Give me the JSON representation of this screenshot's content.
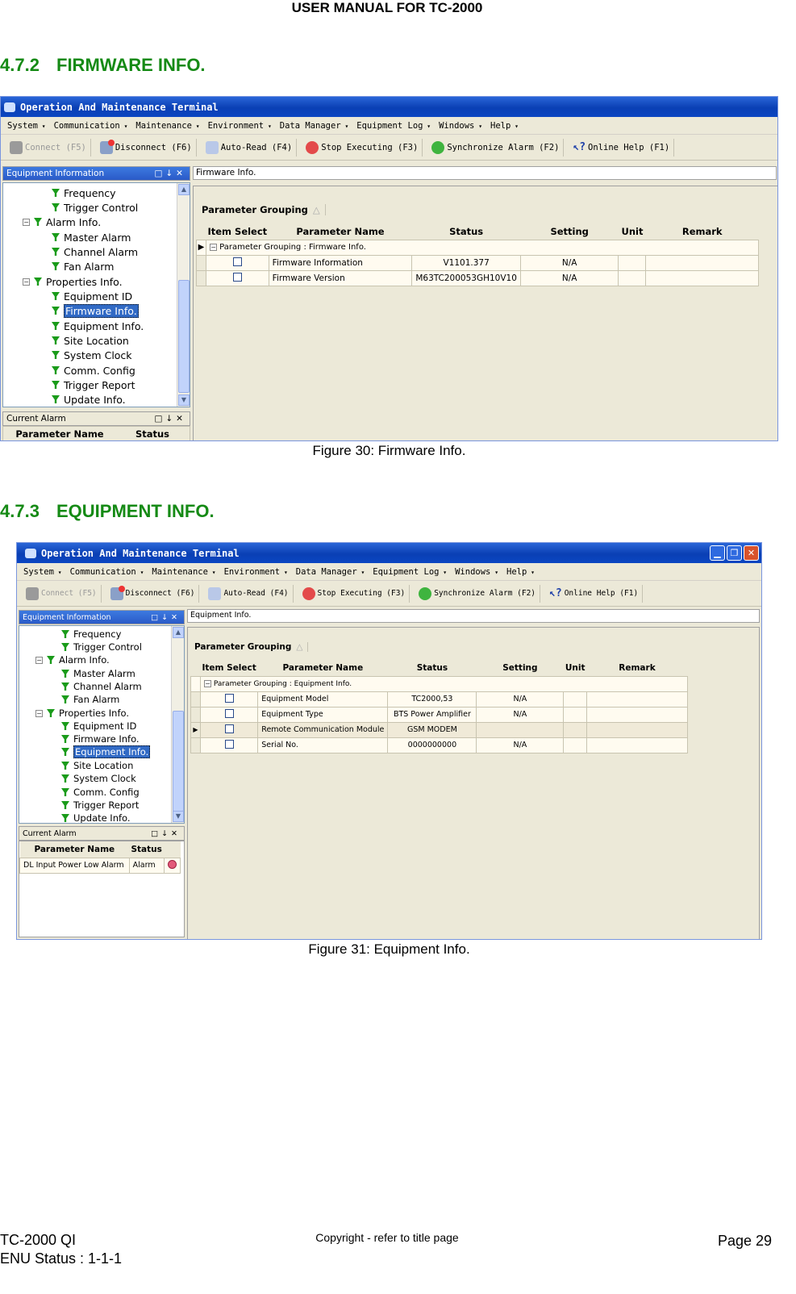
{
  "header": {
    "title": "USER MANUAL FOR TC-2000"
  },
  "section1": {
    "number": "4.7.2",
    "title": "FIRMWARE INFO."
  },
  "section2": {
    "number": "4.7.3",
    "title": "EQUIPMENT INFO."
  },
  "figure1": {
    "caption": "Figure 30: Firmware Info.",
    "window_title": "Operation And Maintenance Terminal",
    "menu": [
      "System",
      "Communication",
      "Maintenance",
      "Environment",
      "Data Manager",
      "Equipment Log",
      "Windows",
      "Help"
    ],
    "toolbar": [
      "Connect (F5)",
      "Disconnect (F6)",
      "Auto-Read (F4)",
      "Stop Executing (F3)",
      "Synchronize Alarm (F2)",
      "Online Help (F1)"
    ],
    "left_panel_title": "Equipment Information",
    "tree": [
      "Frequency",
      "Trigger Control",
      "Alarm Info.",
      "Master Alarm",
      "Channel Alarm",
      "Fan Alarm",
      "Properties Info.",
      "Equipment ID",
      "Firmware Info.",
      "Equipment Info.",
      "Site Location",
      "System Clock",
      "Comm. Config",
      "Trigger Report",
      "Update Info."
    ],
    "selected_item": "Firmware Info.",
    "current_alarm_title": "Current Alarm",
    "alarm_columns": [
      "Parameter Name",
      "Status"
    ],
    "doc_tab": "Firmware Info.",
    "group_button": "Parameter Grouping",
    "columns": [
      "Item Select",
      "Parameter Name",
      "Status",
      "Setting",
      "Unit",
      "Remark"
    ],
    "group_row": "Parameter Grouping : Firmware Info.",
    "rows": [
      {
        "name": "Firmware Information",
        "status": "V1101.377",
        "setting": "N/A"
      },
      {
        "name": "Firmware Version",
        "status": "M63TC200053GH10V10",
        "setting": "N/A"
      }
    ]
  },
  "figure2": {
    "caption": "Figure 31: Equipment Info.",
    "window_title": "Operation And Maintenance Terminal",
    "menu": [
      "System",
      "Communication",
      "Maintenance",
      "Environment",
      "Data Manager",
      "Equipment Log",
      "Windows",
      "Help"
    ],
    "toolbar": [
      "Connect (F5)",
      "Disconnect (F6)",
      "Auto-Read (F4)",
      "Stop Executing (F3)",
      "Synchronize Alarm (F2)",
      "Online Help (F1)"
    ],
    "left_panel_title": "Equipment Information",
    "tree": [
      "Frequency",
      "Trigger Control",
      "Alarm Info.",
      "Master Alarm",
      "Channel Alarm",
      "Fan Alarm",
      "Properties Info.",
      "Equipment ID",
      "Firmware Info.",
      "Equipment Info.",
      "Site Location",
      "System Clock",
      "Comm. Config",
      "Trigger Report",
      "Update Info."
    ],
    "selected_item": "Equipment Info.",
    "current_alarm_title": "Current Alarm",
    "alarm_columns": [
      "Parameter Name",
      "Status"
    ],
    "alarm_rows": [
      {
        "name": "DL Input Power Low Alarm",
        "status": "Alarm"
      }
    ],
    "doc_tab": "Equipment Info.",
    "group_button": "Parameter Grouping",
    "columns": [
      "Item Select",
      "Parameter Name",
      "Status",
      "Setting",
      "Unit",
      "Remark"
    ],
    "group_row": "Parameter Grouping : Equipment Info.",
    "rows": [
      {
        "name": "Equipment Model",
        "status": "TC2000,53",
        "setting": "N/A"
      },
      {
        "name": "Equipment Type",
        "status": "BTS Power Amplifier",
        "setting": "N/A"
      },
      {
        "name": "Remote Communication Module",
        "status": "GSM MODEM",
        "setting": ""
      },
      {
        "name": "Serial No.",
        "status": "0000000000",
        "setting": "N/A"
      }
    ]
  },
  "footer": {
    "doc": "TC-2000 QI",
    "status": "ENU Status : 1-1-1",
    "copyright": "Copyright - refer to title page",
    "page": "Page 29"
  }
}
